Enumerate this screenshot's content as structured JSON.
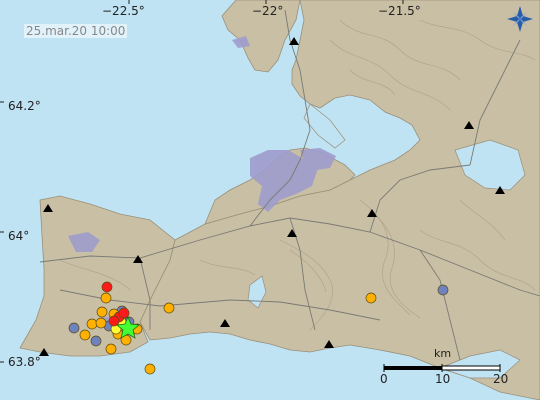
{
  "timestamp": "25.mar.20  10:00",
  "lon_labels": [
    "−22.5°",
    "−22°",
    "−21.5°"
  ],
  "lat_labels": [
    "64.2°",
    "64°",
    "63.8°"
  ],
  "scale": {
    "unit": "km",
    "ticks": [
      "0",
      "10",
      "20"
    ]
  },
  "colors": {
    "sea": "#bfe3f3",
    "land": "#c9bfa4",
    "contour": "#a89c84",
    "lake": "#bfe3f3",
    "urban": "#9e9ccc",
    "glacier": "#ffffff",
    "recent_quake": "#ff1a1a",
    "hour_quake": "#ffff33",
    "day_quake": "#ffb000",
    "older_quake": "#6f82c0",
    "largest_quake": "#44ff33",
    "station": "#000000"
  },
  "compass_icon": "north-arrow-icon",
  "largest_marker_icon": "star-icon",
  "station_marker_icon": "triangle-icon"
}
